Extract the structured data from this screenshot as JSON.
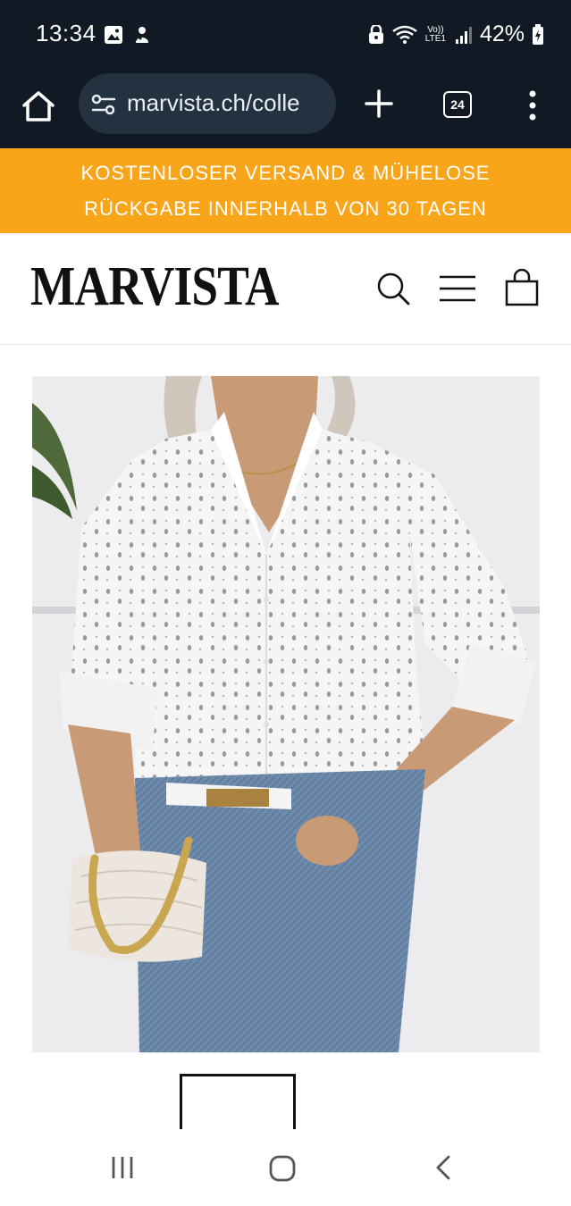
{
  "status_bar": {
    "time": "13:34",
    "network": "Vo)\nLTE1",
    "network_top": "Vo))",
    "network_bottom": "LTE1",
    "battery": "42%"
  },
  "browser": {
    "url": "marvista.ch/colle",
    "tab_count": "24"
  },
  "promo": {
    "line1": "KOSTENLOSER VERSAND & MÜHELOSE",
    "line2": "RÜCKGABE INNERHALB VON 30 TAGEN",
    "color": "#f8a51a"
  },
  "site": {
    "logo": "MARVISTA"
  }
}
